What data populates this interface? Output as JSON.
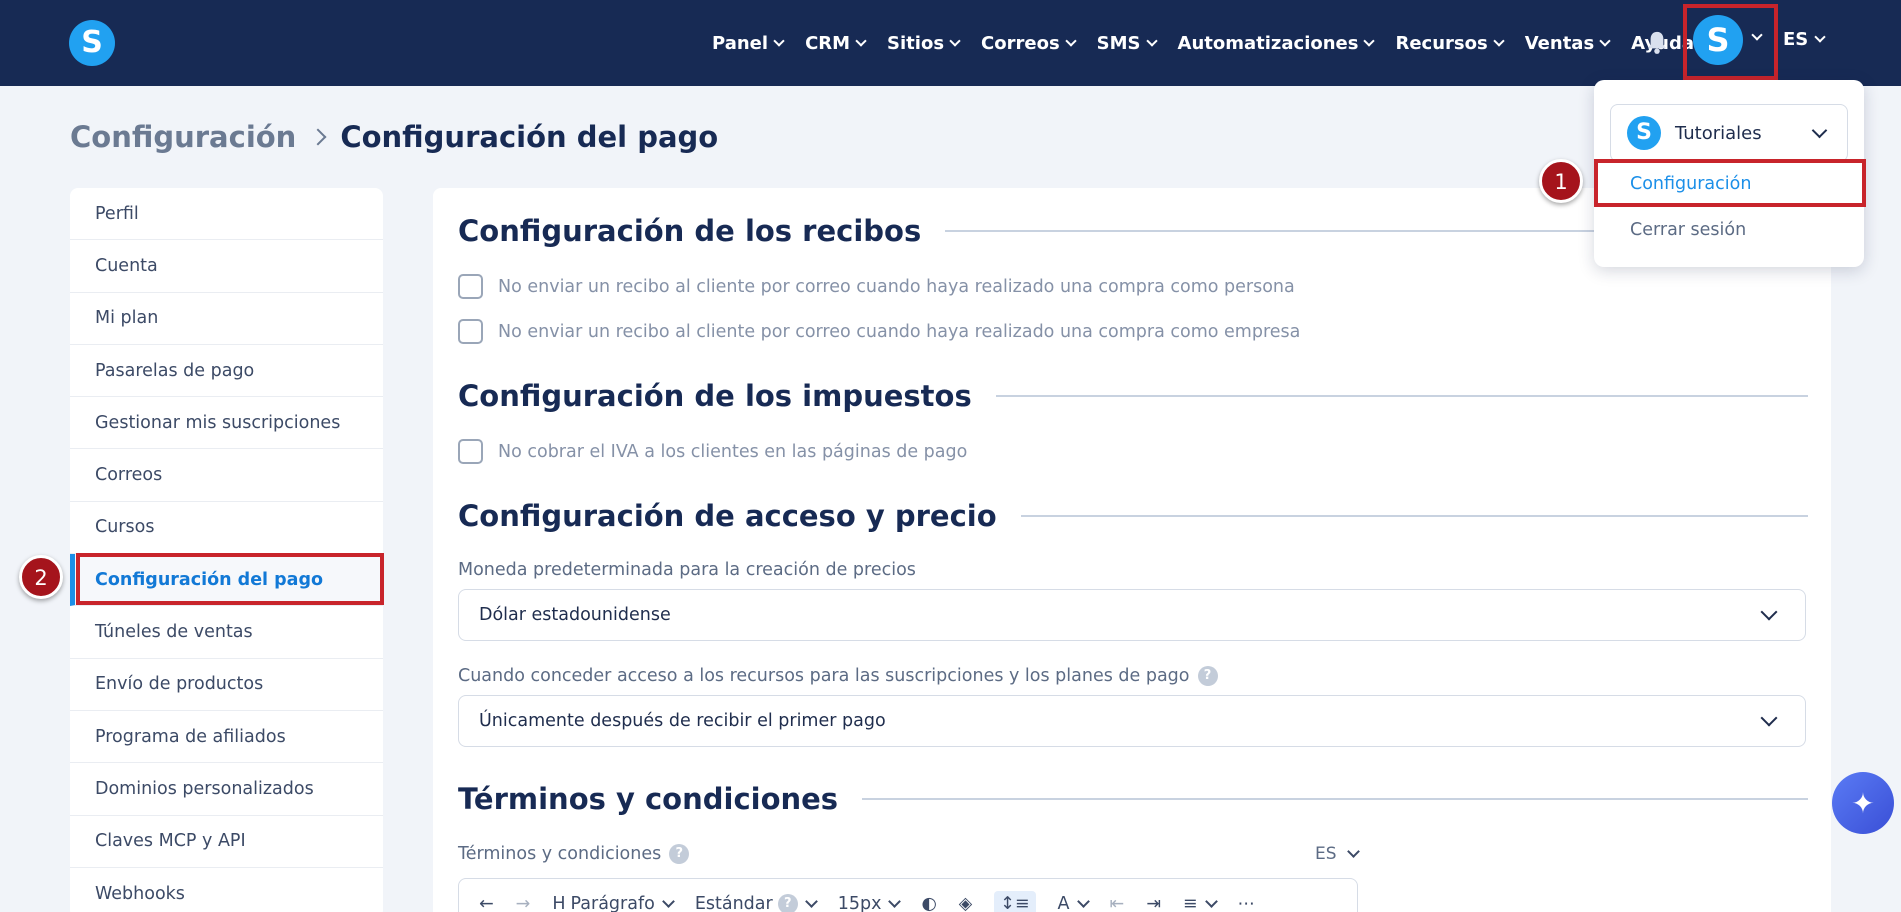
{
  "brand": {
    "logo_letter": "S"
  },
  "nav": {
    "items": [
      {
        "label": "Panel",
        "has_menu": true
      },
      {
        "label": "CRM",
        "has_menu": true
      },
      {
        "label": "Sitios",
        "has_menu": true
      },
      {
        "label": "Correos",
        "has_menu": true
      },
      {
        "label": "SMS",
        "has_menu": true
      },
      {
        "label": "Automatizaciones",
        "has_menu": true
      },
      {
        "label": "Recursos",
        "has_menu": true
      },
      {
        "label": "Ventas",
        "has_menu": true
      },
      {
        "label": "Ayuda",
        "has_menu": false
      }
    ],
    "avatar_letter": "S",
    "language": "ES"
  },
  "breadcrumb": {
    "parent": "Configuración",
    "current": "Configuración del pago"
  },
  "sidebar": {
    "items": [
      {
        "label": "Perfil"
      },
      {
        "label": "Cuenta"
      },
      {
        "label": "Mi plan"
      },
      {
        "label": "Pasarelas de pago"
      },
      {
        "label": "Gestionar mis suscripciones"
      },
      {
        "label": "Correos"
      },
      {
        "label": "Cursos"
      },
      {
        "label": "Configuración del pago",
        "active": true
      },
      {
        "label": "Túneles de ventas"
      },
      {
        "label": "Envío de productos"
      },
      {
        "label": "Programa de afiliados"
      },
      {
        "label": "Dominios personalizados"
      },
      {
        "label": "Claves MCP y API"
      },
      {
        "label": "Webhooks"
      }
    ]
  },
  "main": {
    "receipts": {
      "title": "Configuración de los recibos",
      "opt_person": "No enviar un recibo al cliente por correo cuando haya realizado una compra como persona",
      "opt_company": "No enviar un recibo al cliente por correo cuando haya realizado una compra como empresa"
    },
    "taxes": {
      "title": "Configuración de los impuestos",
      "opt_vat": "No cobrar el IVA a los clientes en las páginas de pago"
    },
    "access": {
      "title": "Configuración de acceso y precio",
      "currency_label": "Moneda predeterminada para la creación de precios",
      "currency_value": "Dólar estadounidense",
      "grant_label": "Cuando conceder acceso a los recursos para las suscripciones y los planes de pago",
      "grant_value": "Únicamente después de recibir el primer pago"
    },
    "terms": {
      "title": "Términos y condiciones",
      "field_label": "Términos y condiciones",
      "language": "ES",
      "toolbar": {
        "paragraph": "Parágrafo",
        "font": "Estándar",
        "size": "15px"
      }
    }
  },
  "dropdown": {
    "account_name": "Tutoriales",
    "account_logo_letter": "S",
    "settings_label": "Configuración",
    "logout_label": "Cerrar sesión"
  },
  "annotations": {
    "step1": "1",
    "step2": "2"
  },
  "colors": {
    "navbar": "#172a54",
    "brand_blue": "#21a1f1",
    "link_blue": "#1b8fe8",
    "highlight_red": "#c8242b",
    "badge_red": "#a5141c"
  }
}
